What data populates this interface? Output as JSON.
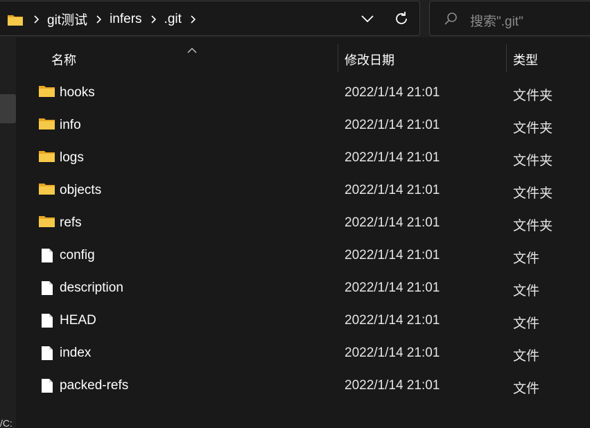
{
  "address": {
    "breadcrumbs": [
      "git测试",
      "infers",
      ".git"
    ]
  },
  "search": {
    "placeholder": "搜索\".git\""
  },
  "columns": {
    "name": "名称",
    "date": "修改日期",
    "type": "类型"
  },
  "files": [
    {
      "name": "hooks",
      "date": "2022/1/14 21:01",
      "type": "文件夹",
      "icon": "folder-icon"
    },
    {
      "name": "info",
      "date": "2022/1/14 21:01",
      "type": "文件夹",
      "icon": "folder-icon"
    },
    {
      "name": "logs",
      "date": "2022/1/14 21:01",
      "type": "文件夹",
      "icon": "folder-icon"
    },
    {
      "name": "objects",
      "date": "2022/1/14 21:01",
      "type": "文件夹",
      "icon": "folder-icon"
    },
    {
      "name": "refs",
      "date": "2022/1/14 21:01",
      "type": "文件夹",
      "icon": "folder-icon"
    },
    {
      "name": "config",
      "date": "2022/1/14 21:01",
      "type": "文件",
      "icon": "file-icon"
    },
    {
      "name": "description",
      "date": "2022/1/14 21:01",
      "type": "文件",
      "icon": "file-icon"
    },
    {
      "name": "HEAD",
      "date": "2022/1/14 21:01",
      "type": "文件",
      "icon": "file-icon"
    },
    {
      "name": "index",
      "date": "2022/1/14 21:01",
      "type": "文件",
      "icon": "file-icon"
    },
    {
      "name": "packed-refs",
      "date": "2022/1/14 21:01",
      "type": "文件",
      "icon": "file-icon"
    }
  ],
  "left_pane": {
    "partial_text": "/C:"
  },
  "colors": {
    "background": "#191919",
    "folder": "#f7c948",
    "text": "#ffffff"
  }
}
